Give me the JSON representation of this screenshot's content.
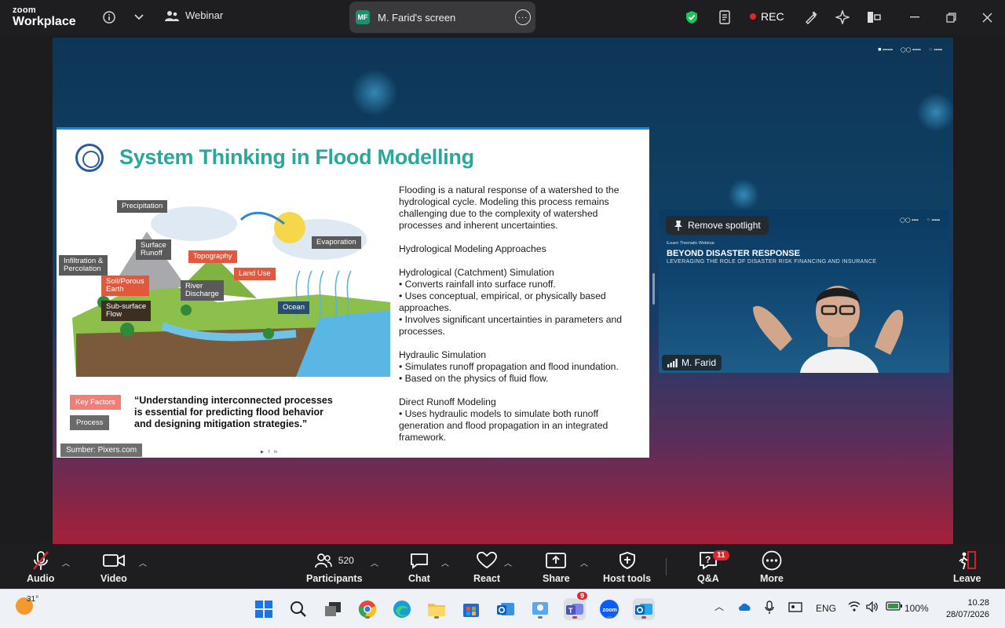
{
  "app": {
    "logo_line1": "zoom",
    "logo_line2": "Workplace"
  },
  "topbar": {
    "meeting_type": "Webinar",
    "screen_share": {
      "initials": "MF",
      "label": "M. Farid's screen"
    },
    "rec_label": "REC"
  },
  "slide": {
    "title": "System Thinking in Flood Modelling",
    "intro": "Flooding is a natural response of a watershed to the hydrological cycle. Modeling this process remains challenging due to the complexity of watershed processes and inherent uncertainties.",
    "approaches_heading": "Hydrological Modeling Approaches",
    "sections": [
      {
        "heading": "Hydrological (Catchment) Simulation",
        "bullets": [
          "• Converts rainfall into surface runoff.",
          "• Uses conceptual, empirical, or physically based approaches.",
          "• Involves significant uncertainties in parameters and processes."
        ]
      },
      {
        "heading": "Hydraulic Simulation",
        "bullets": [
          "• Simulates runoff propagation and flood inundation.",
          "• Based on the physics of fluid flow."
        ]
      },
      {
        "heading": "Direct Runoff Modeling",
        "bullets": [
          "• Uses hydraulic models to simulate both runoff generation and flood propagation in an integrated framework."
        ]
      }
    ],
    "diagram_labels": {
      "precipitation": "Precipitation",
      "surface_runoff": "Surface\nRunoff",
      "topography": "Topography",
      "infiltration": "Infiltration &\nPercolation",
      "soil": "Soil/Porous\nEarth",
      "river": "River\nDischarge",
      "land_use": "Land Use",
      "evaporation": "Evaporation",
      "subsurface": "Sub-surface\nFlow",
      "ocean": "Ocean"
    },
    "legend_key": "Key Factors",
    "legend_process": "Process",
    "quote": "“Understanding interconnected processes is essential for predicting flood behavior and designing mitigation strategies.”",
    "source": "Sumber: Pixers.com"
  },
  "video": {
    "spotlight_label": "Remove spotlight",
    "event_sub": "iLearn Thematic Webinar",
    "event_title": "BEYOND DISASTER RESPONSE",
    "event_tagline": "LEVERAGING THE ROLE OF DISASTER RISK FINANCING AND INSURANCE",
    "participant_name": "M. Farid"
  },
  "toolbar": {
    "audio": "Audio",
    "video": "Video",
    "participants": "Participants",
    "participants_count": "520",
    "chat": "Chat",
    "react": "React",
    "share": "Share",
    "host_tools": "Host tools",
    "qa": "Q&A",
    "qa_badge": "11",
    "more": "More",
    "leave": "Leave"
  },
  "taskbar": {
    "temperature": "31°",
    "teams_badge": "9",
    "language": "ENG",
    "battery": "100%",
    "time": "10.28",
    "date": "28/07/2026"
  },
  "colors": {
    "accent_green": "#28a79a",
    "rec_red": "#e0252b",
    "toolbar_bg": "#1e1e20"
  }
}
